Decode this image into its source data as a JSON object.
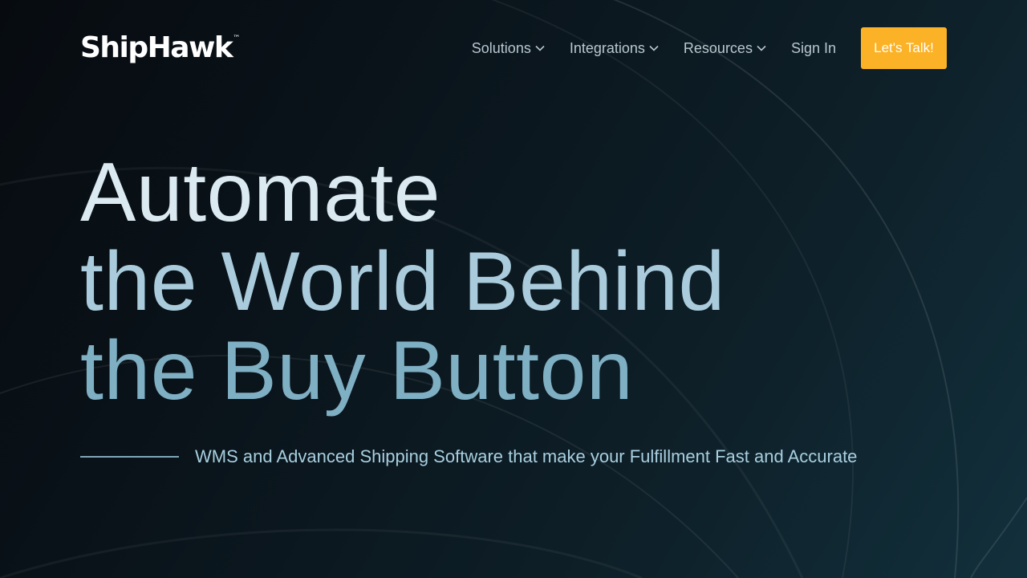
{
  "brand": {
    "logo_text": "ShipHawk",
    "logo_mark": "™"
  },
  "nav": {
    "items": [
      {
        "label": "Solutions",
        "has_dropdown": true
      },
      {
        "label": "Integrations",
        "has_dropdown": true
      },
      {
        "label": "Resources",
        "has_dropdown": true
      },
      {
        "label": "Sign In",
        "has_dropdown": false
      }
    ],
    "cta_label": "Let's Talk!"
  },
  "hero": {
    "line1": "Automate",
    "line2": "the World Behind",
    "line3": "the Buy Button",
    "tagline": "WMS and Advanced Shipping Software that make your Fulfillment Fast and Accurate"
  },
  "colors": {
    "cta": "#fbb226",
    "background": "#0a141b",
    "accent_text": "#a8cfe0"
  },
  "icons": {
    "dropdown": "chevron-down-icon"
  }
}
